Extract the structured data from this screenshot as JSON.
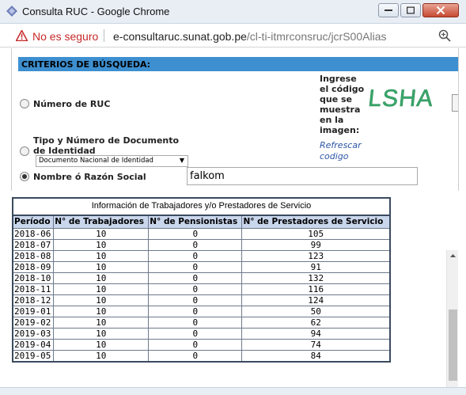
{
  "window": {
    "title": "Consulta RUC - Google Chrome"
  },
  "address_bar": {
    "security_label": "No es seguro",
    "url_host": "e-consultaruc.sunat.gob.pe",
    "url_path": "/cl-ti-itmrconsruc/jcrS00Alias"
  },
  "form": {
    "section_title": "CRITERIOS DE BÚSQUEDA:",
    "options": [
      {
        "label": "Número de RUC",
        "checked": false
      },
      {
        "label": "Tipo y Número de Documento de Identidad",
        "checked": false
      },
      {
        "label": "Nombre ó Razón Social",
        "checked": true
      }
    ],
    "document_type_selected": "Documento Nacional de Identidad",
    "name_input_value": "falkom",
    "captcha_prompt": "Ingrese el código que se muestra en la imagen:",
    "captcha_value": "LSHA",
    "refresh_link": "Refrescar codigo"
  },
  "table": {
    "caption": "Información de Trabajadores y/o Prestadores de Servicio",
    "headers": [
      "Período",
      "N° de Trabajadores",
      "N° de Pensionistas",
      "N° de Prestadores de Servicio"
    ],
    "rows": [
      [
        "2018-06",
        "10",
        "0",
        "105"
      ],
      [
        "2018-07",
        "10",
        "0",
        "99"
      ],
      [
        "2018-08",
        "10",
        "0",
        "123"
      ],
      [
        "2018-09",
        "10",
        "0",
        "91"
      ],
      [
        "2018-10",
        "10",
        "0",
        "132"
      ],
      [
        "2018-11",
        "10",
        "0",
        "116"
      ],
      [
        "2018-12",
        "10",
        "0",
        "124"
      ],
      [
        "2019-01",
        "10",
        "0",
        "50"
      ],
      [
        "2019-02",
        "10",
        "0",
        "62"
      ],
      [
        "2019-03",
        "10",
        "0",
        "94"
      ],
      [
        "2019-04",
        "10",
        "0",
        "74"
      ],
      [
        "2019-05",
        "10",
        "0",
        "84"
      ]
    ]
  },
  "colors": {
    "section_header": "#3d8fd0",
    "table_header": "#c9d6ec",
    "not_secure": "#c62828",
    "link": "#2b55a5"
  },
  "icons": [
    "app-icon",
    "minimize-icon",
    "maximize-icon",
    "close-icon",
    "warning-icon",
    "zoom-icon",
    "scroll-up-icon",
    "scroll-down-icon"
  ]
}
